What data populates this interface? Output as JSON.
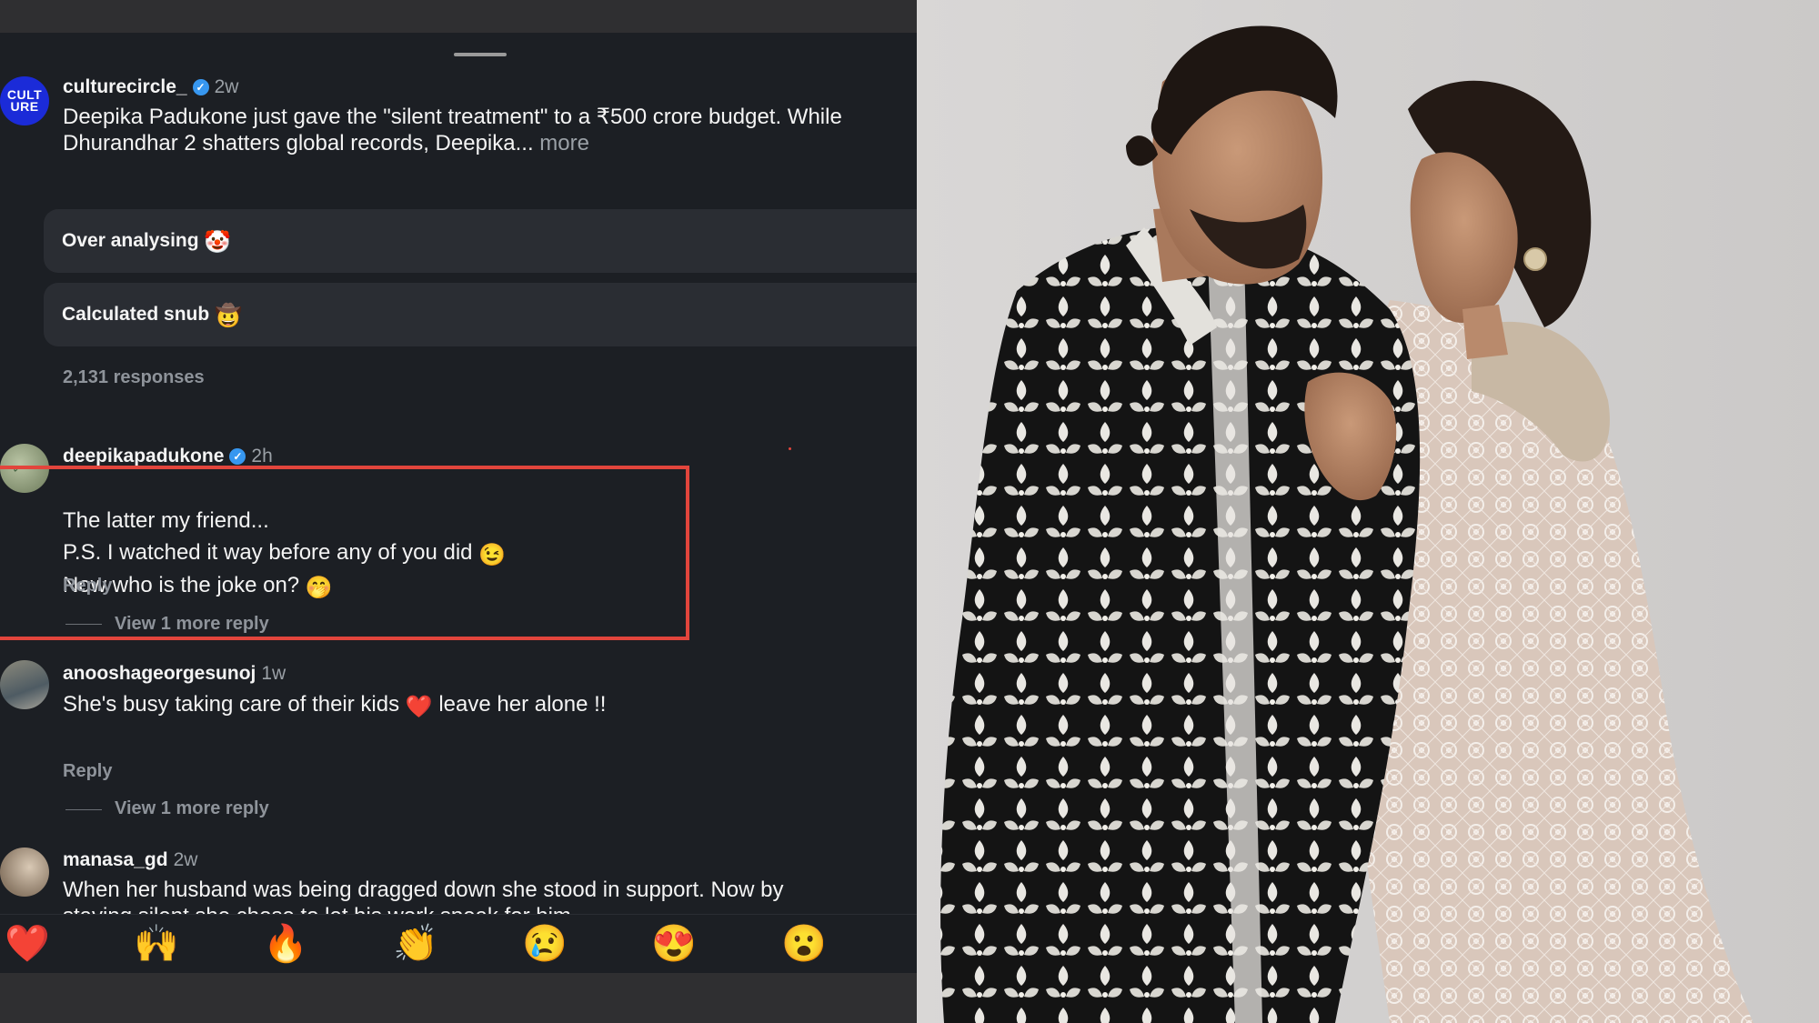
{
  "post": {
    "username": "culturecircle_",
    "avatar_text": [
      "CULT",
      "URE"
    ],
    "time": "2w",
    "caption_line1": "Deepika Padukone just gave the \"silent treatment\" to a ₹500 crore budget. While",
    "caption_line2": "Dhurandhar 2 shatters global records, Deepika...",
    "more_label": "more"
  },
  "poll": {
    "options": [
      {
        "label": "Over analysing",
        "emoji": "🤡"
      },
      {
        "label": "Calculated snub",
        "emoji": "🤠"
      }
    ],
    "responses": "2,131 responses"
  },
  "comments": [
    {
      "username": "deepikapadukone",
      "verified": true,
      "time": "2h",
      "lines": [
        "The latter my friend...",
        "P.S. I watched it way before any of you did",
        "Now who is the joke on?"
      ],
      "line_emojis": [
        "",
        "😉",
        "🤭"
      ],
      "reply_label": "Reply",
      "view_more": "View 1 more reply"
    },
    {
      "username": "anooshageorgesunoj",
      "time": "1w",
      "text_before": "She's busy taking care of their kids",
      "emoji": "❤️",
      "text_after": "leave her alone !!",
      "reply_label": "Reply",
      "view_more": "View 1 more reply"
    },
    {
      "username": "manasa_gd",
      "time": "2w",
      "lines": [
        "When her husband was being dragged down she stood in support. Now by",
        "staying silent she chose to let his work speak for him."
      ]
    }
  ],
  "reactions": [
    "❤️",
    "🙌",
    "🔥",
    "👏",
    "😢",
    "😍",
    "😮"
  ],
  "colors": {
    "highlight": "#e2453c",
    "panel_bg": "#1c1f24",
    "verified": "#3797f0"
  }
}
